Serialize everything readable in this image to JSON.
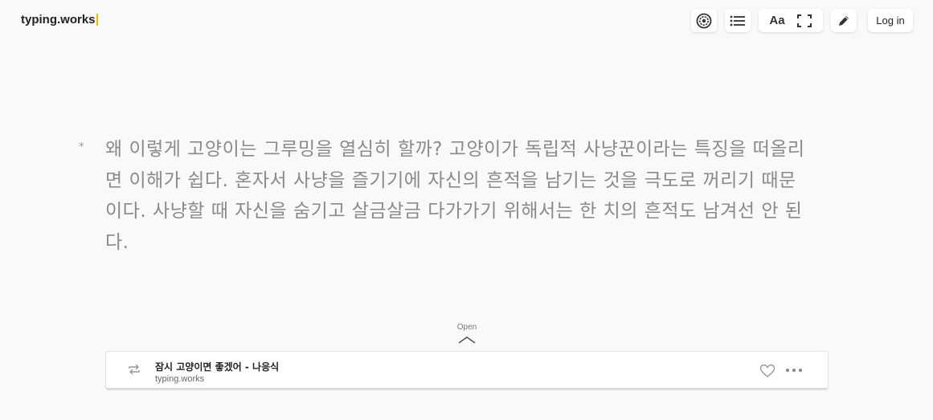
{
  "header": {
    "logo_text": "typing.works",
    "login_label": "Log in",
    "font_button_label": "Aa",
    "icons": [
      "settings-icon",
      "list-icon",
      "font-icon",
      "fullscreen-icon",
      "pencil-icon"
    ]
  },
  "passage": {
    "bullet": "*",
    "text": "왜 이렇게 고양이는 그루밍을 열심히 할까? 고양이가 독립적 사냥꾼이라는 특징을 떠올리면 이해가 쉽다. 혼자서 사냥을 즐기기에 자신의 흔적을 남기는 것을 극도로 꺼리기 때문이다. 사냥할 때 자신을 숨기고 살금살금 다가가기 위해서는 한 치의 흔적도 남겨선 안 된다."
  },
  "player": {
    "open_label": "Open",
    "title": "잠시 고양이면 좋겠어 - 나응식",
    "source": "typing.works"
  },
  "colors": {
    "caret": "#f2b705",
    "background": "#f9f9f9",
    "passage_text": "#8a8a8a"
  }
}
